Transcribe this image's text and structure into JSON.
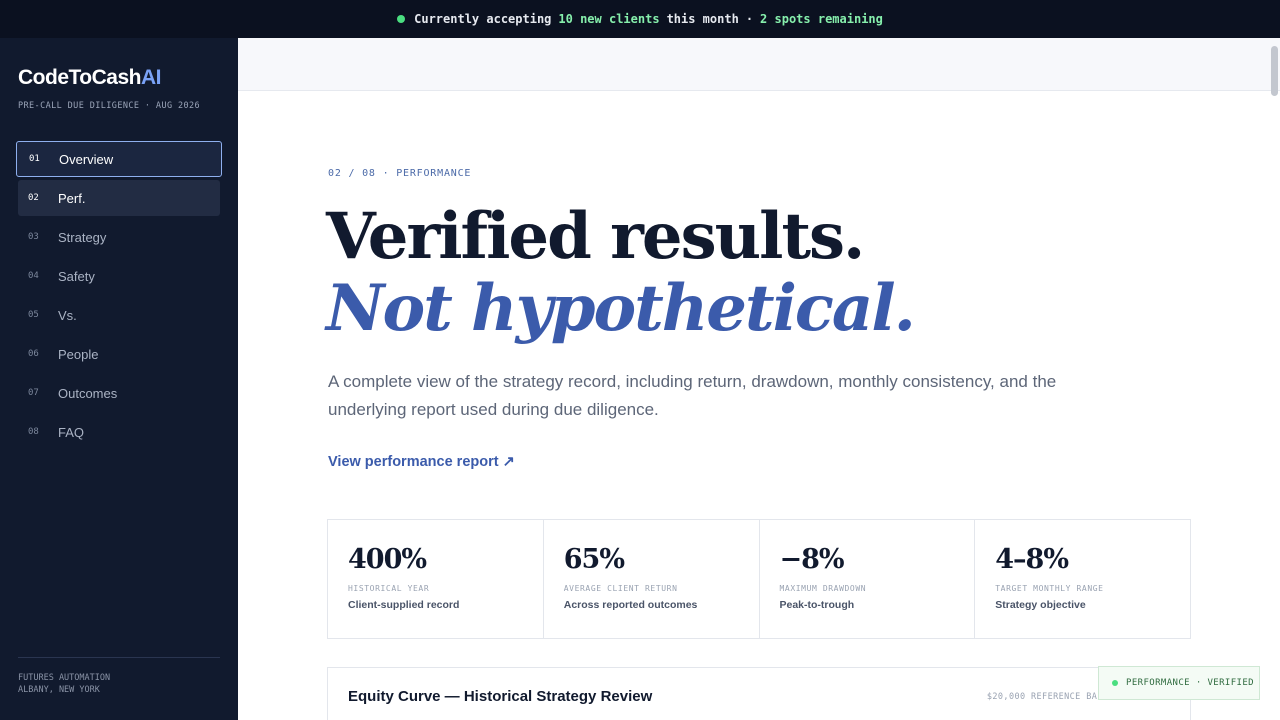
{
  "banner": {
    "t1": "Currently accepting",
    "t2": "10 new clients",
    "t3": "this month",
    "t4": "·",
    "t5": "2 spots remaining"
  },
  "brand": {
    "name_main": "CodeToCash",
    "name_accent": "AI",
    "subtitle": "PRE-CALL DUE DILIGENCE · AUG 2026"
  },
  "nav": [
    {
      "num": "01",
      "label": "Overview"
    },
    {
      "num": "02",
      "label": "Perf."
    },
    {
      "num": "03",
      "label": "Strategy"
    },
    {
      "num": "04",
      "label": "Safety"
    },
    {
      "num": "05",
      "label": "Vs."
    },
    {
      "num": "06",
      "label": "People"
    },
    {
      "num": "07",
      "label": "Outcomes"
    },
    {
      "num": "08",
      "label": "FAQ"
    }
  ],
  "sidebar_footer": {
    "line1": "FUTURES AUTOMATION",
    "line2": "ALBANY, NEW YORK"
  },
  "main": {
    "eyebrow": "02 / 08 · PERFORMANCE",
    "heading_line1": "Verified results.",
    "heading_line2": "Not hypothetical.",
    "lead": "A complete view of the strategy record, including return, drawdown, monthly consistency, and the underlying report used during due diligence.",
    "report_link": "View performance report ↗",
    "stats": [
      {
        "value": "400%",
        "caption": "HISTORICAL YEAR",
        "desc": "Client-supplied record"
      },
      {
        "value": "65%",
        "caption": "AVERAGE CLIENT RETURN",
        "desc": "Across reported outcomes"
      },
      {
        "value": "−8%",
        "caption": "MAXIMUM DRAWDOWN",
        "desc": "Peak-to-trough"
      },
      {
        "value": "4–8%",
        "caption": "TARGET MONTHLY RANGE",
        "desc": "Strategy objective"
      }
    ],
    "equity_title": "Equity Curve — Historical Strategy Review",
    "equity_meta": "$20,000 REFERENCE BALANCE · FUTURES"
  },
  "badge": "PERFORMANCE · VERIFIED",
  "colors": {
    "accent": "#3b5bab",
    "sidebar_bg": "#111a2e",
    "banner_bg": "#0b1120",
    "status_green": "#4ade80"
  }
}
